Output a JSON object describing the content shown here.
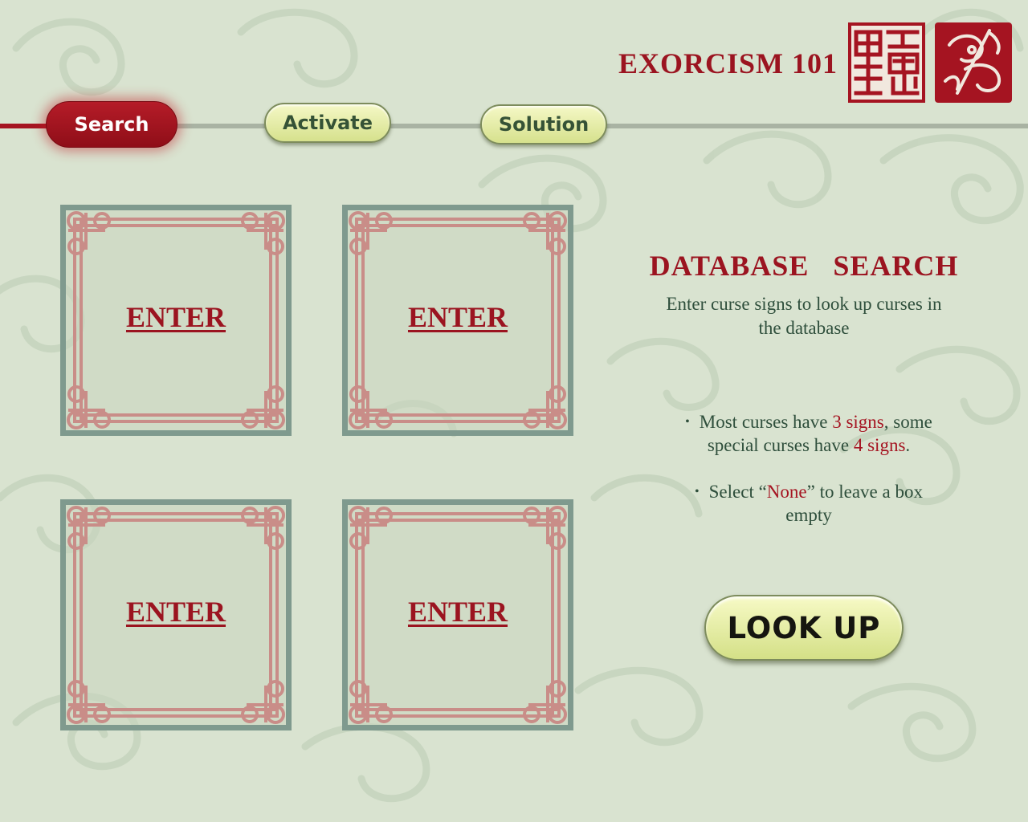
{
  "header": {
    "app_title": "EXORCISM 101",
    "seal_icons": [
      "seal-calligraphy-icon",
      "seal-dragon-icon"
    ]
  },
  "nav": {
    "tabs": [
      {
        "label": "Search",
        "active": true
      },
      {
        "label": "Activate",
        "active": false
      },
      {
        "label": "Solution",
        "active": false
      }
    ]
  },
  "entry_boxes": [
    {
      "label": "ENTER"
    },
    {
      "label": "ENTER"
    },
    {
      "label": "ENTER"
    },
    {
      "label": "ENTER"
    }
  ],
  "panel": {
    "title": "DATABASE   SEARCH",
    "subtitle": "Enter curse signs to look up curses in the database",
    "tip1": {
      "a": "Most curses have ",
      "b": "3 signs",
      "c": ", some special curses have ",
      "d": "4 signs",
      "e": "."
    },
    "tip2": {
      "a": "Select “",
      "b": "None",
      "c": "” to leave a box empty"
    },
    "lookup_label": "LOOK UP"
  },
  "colors": {
    "accent_red": "#9b1420",
    "background": "#d9e3d0",
    "button_green": "#d6e18d",
    "frame_teal": "#7f9a8e",
    "frame_pink": "#c98d88"
  }
}
